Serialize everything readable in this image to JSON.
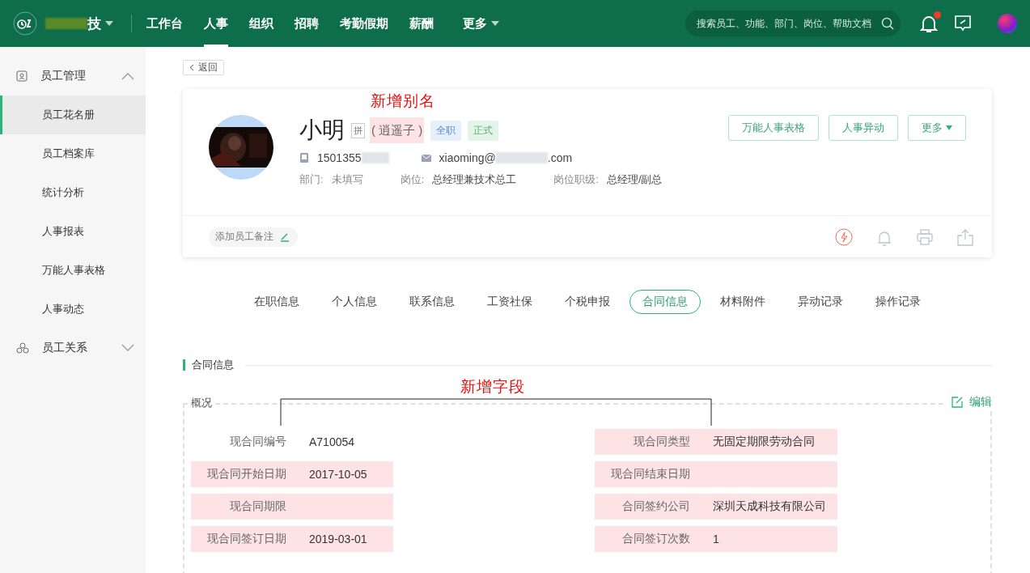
{
  "topbar": {
    "company": "技",
    "nav": [
      {
        "label": "工作台",
        "selected": false
      },
      {
        "label": "人事",
        "selected": true
      },
      {
        "label": "组织",
        "selected": false
      },
      {
        "label": "招聘",
        "selected": false
      },
      {
        "label": "考勤假期",
        "selected": false
      },
      {
        "label": "薪酬",
        "selected": false
      },
      {
        "label": "更多",
        "selected": false,
        "dropdown": true
      }
    ],
    "search": {
      "placeholder": "搜索员工、功能、部门、岗位、帮助文档"
    },
    "notifications": {
      "unread": true
    }
  },
  "sidebar": {
    "groups": [
      {
        "label": "员工管理",
        "expanded": true,
        "children": [
          {
            "label": "员工花名册",
            "selected": true
          },
          {
            "label": "员工档案库",
            "selected": false
          },
          {
            "label": "统计分析",
            "selected": false
          },
          {
            "label": "人事报表",
            "selected": false
          },
          {
            "label": "万能人事表格",
            "selected": false
          },
          {
            "label": "人事动态",
            "selected": false
          }
        ]
      },
      {
        "label": "员工关系",
        "expanded": false
      }
    ]
  },
  "back_button": "返回",
  "profile": {
    "name": "小明",
    "pinyin_mark": "拼",
    "alias": "( 逍遥子 )",
    "tags": [
      {
        "label": "全职",
        "color": "#e6f0fc"
      },
      {
        "label": "正式",
        "color": "#e3f5e9"
      }
    ],
    "phone": "1501355",
    "email_user": "xiaoming@",
    "email_domain": ".com",
    "info": [
      {
        "label": "部门:",
        "value": "未填写",
        "muted": true
      },
      {
        "label": "岗位:",
        "value": "总经理兼技术总工",
        "muted": false
      },
      {
        "label": "岗位职级:",
        "value": "总经理/副总",
        "muted": false
      }
    ],
    "buttons": [
      {
        "label": "万能人事表格",
        "dropdown": false
      },
      {
        "label": "人事异动",
        "dropdown": false
      },
      {
        "label": "更多",
        "dropdown": true
      }
    ],
    "note_button": "添加员工备注"
  },
  "annotations": {
    "alias": "新增别名",
    "fields": "新增字段"
  },
  "tabs": [
    {
      "label": "在职信息",
      "selected": false
    },
    {
      "label": "个人信息",
      "selected": false
    },
    {
      "label": "联系信息",
      "selected": false
    },
    {
      "label": "工资社保",
      "selected": false
    },
    {
      "label": "个税申报",
      "selected": false
    },
    {
      "label": "合同信息",
      "selected": true
    },
    {
      "label": "材料附件",
      "selected": false
    },
    {
      "label": "异动记录",
      "selected": false
    },
    {
      "label": "操作记录",
      "selected": false
    }
  ],
  "section": {
    "title": "合同信息",
    "box_title": "概况",
    "edit": "编辑",
    "fields": [
      {
        "label": "现合同编号",
        "value": "A710054",
        "highlighted": false
      },
      {
        "label": "现合同类型",
        "value": "无固定期限劳动合同",
        "highlighted": true
      },
      {
        "label": "现合同开始日期",
        "value": "2017-10-05",
        "highlighted": true
      },
      {
        "label": "现合同结束日期",
        "highlighted": true
      },
      {
        "label": "现合同期限",
        "highlighted": true
      },
      {
        "label": "合同签约公司",
        "value": "深圳天成科技有限公司",
        "highlighted": true
      },
      {
        "label": "现合同签订日期",
        "value": "2019-03-01",
        "highlighted": true
      },
      {
        "label": "合同签订次数",
        "value": "1",
        "highlighted": true
      }
    ]
  }
}
